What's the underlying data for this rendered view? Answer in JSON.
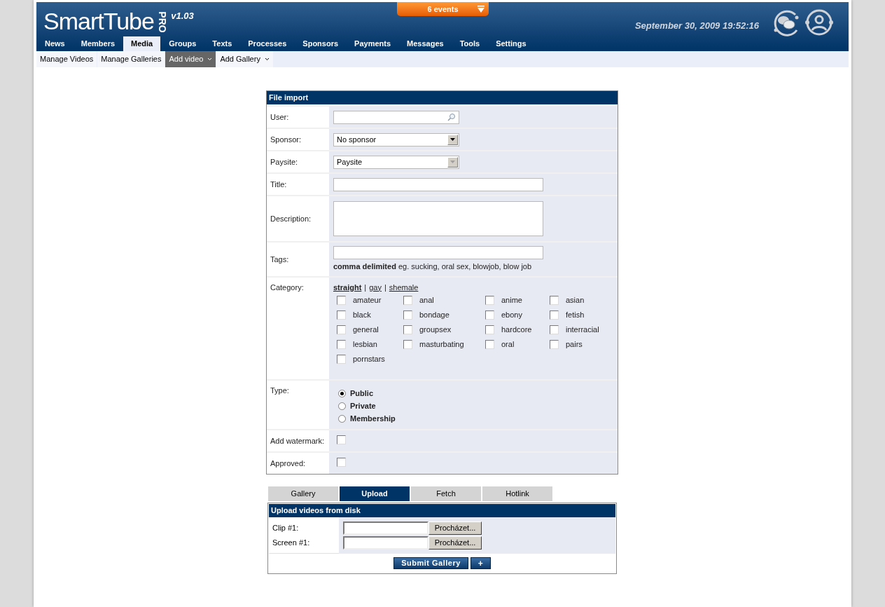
{
  "header": {
    "logo": "SmartTube",
    "edition": "PRO",
    "version": "v1.03",
    "events": "6 events",
    "datetime": "September 30, 2009 19:52:16"
  },
  "nav": [
    {
      "label": "News",
      "selected": false
    },
    {
      "label": "Members",
      "selected": false
    },
    {
      "label": "Media",
      "selected": true
    },
    {
      "label": "Groups",
      "selected": false
    },
    {
      "label": "Texts",
      "selected": false
    },
    {
      "label": "Processes",
      "selected": false
    },
    {
      "label": "Sponsors",
      "selected": false
    },
    {
      "label": "Payments",
      "selected": false
    },
    {
      "label": "Messages",
      "selected": false
    },
    {
      "label": "Tools",
      "selected": false
    },
    {
      "label": "Settings",
      "selected": false
    }
  ],
  "subnav": [
    {
      "label": "Manage Videos",
      "selected": false,
      "menu": false
    },
    {
      "label": "Manage Galleries",
      "selected": false,
      "menu": false
    },
    {
      "label": "Add video",
      "selected": true,
      "menu": true
    },
    {
      "label": "Add Gallery",
      "selected": false,
      "menu": true
    }
  ],
  "form": {
    "title": "File import",
    "rows": [
      {
        "kind": "search",
        "label": "User:"
      },
      {
        "kind": "select",
        "label": "Sponsor:",
        "value": "No sponsor",
        "disabled": false
      },
      {
        "kind": "select",
        "label": "Paysite:",
        "value": "Paysite",
        "disabled": true
      },
      {
        "kind": "text",
        "label": "Title:"
      },
      {
        "kind": "textarea",
        "label": "Description:"
      },
      {
        "kind": "tags",
        "label": "Tags:",
        "hint": "**comma delimited** eg. sucking, oral sex, blowjob, blow job"
      },
      {
        "kind": "category",
        "label": "Category:",
        "separator": "|",
        "filters": [
          {
            "label": "straight",
            "selected": true
          },
          {
            "label": "gay",
            "selected": false
          },
          {
            "label": "shemale",
            "selected": false
          }
        ],
        "options": [
          {
            "label": "amateur",
            "checked": false
          },
          {
            "label": "anal",
            "checked": false
          },
          {
            "label": "anime",
            "checked": false
          },
          {
            "label": "asian",
            "checked": false
          },
          {
            "label": "black",
            "checked": false
          },
          {
            "label": "bondage",
            "checked": false
          },
          {
            "label": "ebony",
            "checked": false
          },
          {
            "label": "fetish",
            "checked": false
          },
          {
            "label": "general",
            "checked": false
          },
          {
            "label": "groupsex",
            "checked": false
          },
          {
            "label": "hardcore",
            "checked": false
          },
          {
            "label": "interracial",
            "checked": false
          },
          {
            "label": "lesbian",
            "checked": false
          },
          {
            "label": "masturbating",
            "checked": false
          },
          {
            "label": "oral",
            "checked": false
          },
          {
            "label": "pairs",
            "checked": false
          },
          {
            "label": "pornstars",
            "checked": false
          }
        ]
      },
      {
        "kind": "radio",
        "label": "Type:",
        "options": [
          {
            "label": "Public",
            "selected": true
          },
          {
            "label": "Private",
            "selected": false
          },
          {
            "label": "Membership",
            "selected": false
          }
        ]
      },
      {
        "kind": "checkbox",
        "label": "Add watermark:",
        "checked": false
      },
      {
        "kind": "checkbox",
        "label": "Approved:",
        "checked": false
      }
    ]
  },
  "upload": {
    "tabs": [
      {
        "label": "Gallery",
        "selected": false
      },
      {
        "label": "Upload",
        "selected": true
      },
      {
        "label": "Fetch",
        "selected": false
      },
      {
        "label": "Hotlink",
        "selected": false
      }
    ],
    "title": "Upload videos from disk",
    "files": [
      {
        "label": "Clip #1:",
        "button": "Procházet..."
      },
      {
        "label": "Screen #1:",
        "button": "Procházet..."
      }
    ],
    "submit": "Submit Gallery",
    "add": "+"
  }
}
